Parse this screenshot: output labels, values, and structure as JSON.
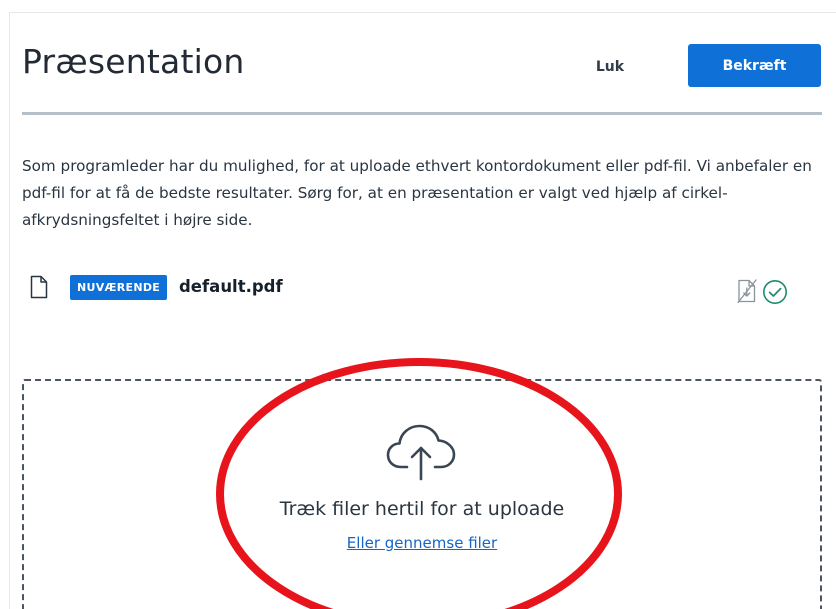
{
  "modal": {
    "title": "Præsentation",
    "close_label": "Luk",
    "confirm_label": "Bekræft",
    "description": "Som programleder har du mulighed, for at uploade ethvert kontordokument eller pdf-fil. Vi anbefaler en pdf-fil for at få de bedste resultater. Sørg for, at en præsentation er valgt ved hjælp af cirkel-afkrydsningsfeltet i højre side."
  },
  "files": [
    {
      "badge": "NUVÆRENDE",
      "name": "default.pdf"
    }
  ],
  "dropzone": {
    "text": "Træk filer hertil for at uploade",
    "browse_label": "Eller gennemse filer"
  },
  "colors": {
    "primary": "#0f70d7",
    "link": "#1565c8",
    "check": "#1f8a70",
    "annotation": "#e8141b",
    "divider": "#b6bec7"
  },
  "icons": {
    "file": "file-icon",
    "download_toggle": "download-disabled-icon",
    "select": "check-circle-icon",
    "upload": "cloud-upload-icon"
  }
}
